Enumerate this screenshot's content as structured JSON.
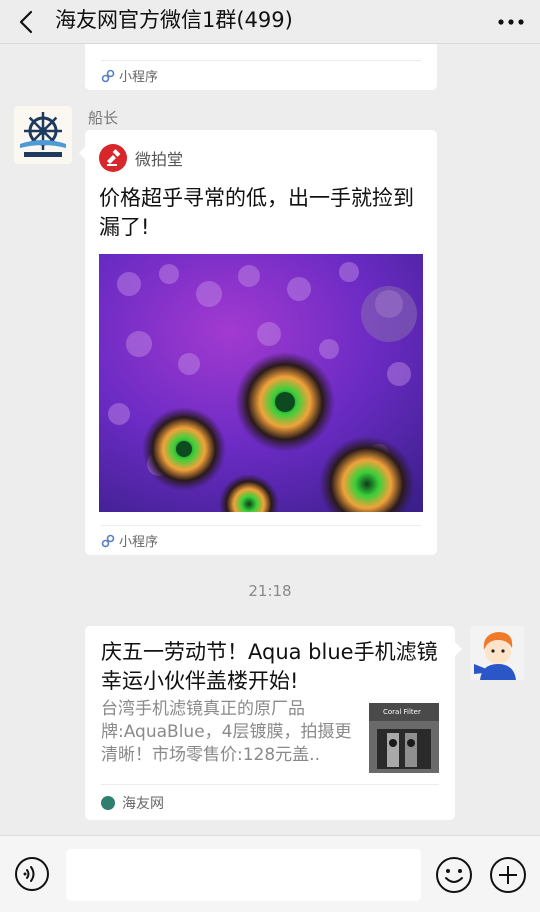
{
  "header": {
    "title": "海友网官方微信1群(499)"
  },
  "messages": {
    "top_card": {
      "footer_label": "小程序"
    },
    "mini_program": {
      "sender_name": "船长",
      "app_name": "微拍堂",
      "title": "价格超乎寻常的低，出一手就捡到漏了!",
      "footer_label": "小程序"
    },
    "timestamp": "21:18",
    "link_card": {
      "title": "庆五一劳动节！Aqua blue手机滤镜幸运小伙伴盖楼开始!",
      "description": "台湾手机滤镜真正的原厂品牌:AquaBlue，4层镀膜，拍摄更清晰！市场零售价:128元盖..",
      "thumbnail_text": "Coral Filter",
      "source": "海友网"
    }
  },
  "input_bar": {
    "placeholder": ""
  },
  "colors": {
    "background": "#ededed",
    "card": "#ffffff",
    "weipaitang_red": "#d9262b",
    "site_icon": "#2f7f6f"
  },
  "icons": {
    "back": "chevron-left-icon",
    "more": "ellipsis-icon",
    "mini_program": "link-icon",
    "voice": "voice-icon",
    "emoji": "emoji-icon",
    "plus": "plus-icon"
  }
}
